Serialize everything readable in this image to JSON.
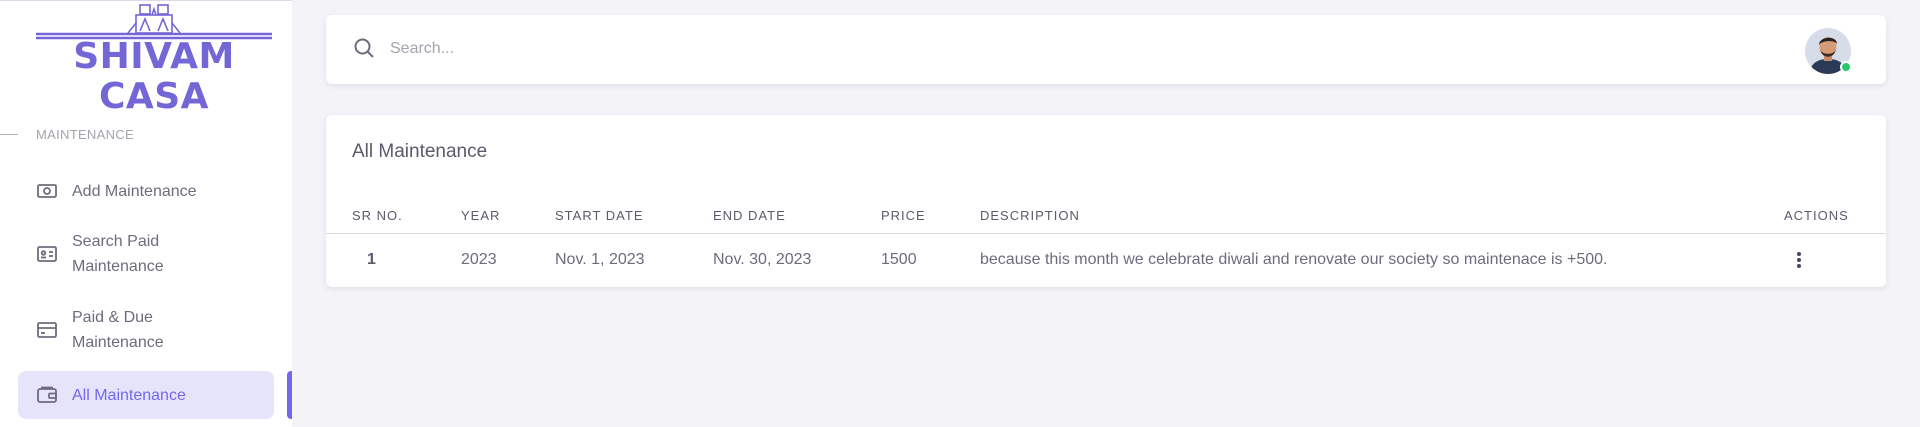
{
  "brand": {
    "name": "SHIVAM CASA",
    "color": "#7367d8"
  },
  "sidebar": {
    "section_header": "MAINTENANCE",
    "items": [
      {
        "label": "Add Maintenance",
        "icon": "cash-icon",
        "active": false
      },
      {
        "label": "Search Paid Maintenance",
        "icon": "id-card-icon",
        "active": false
      },
      {
        "label": "Paid & Due Maintenance",
        "icon": "credit-card-icon",
        "active": false
      },
      {
        "label": "All Maintenance",
        "icon": "wallet-icon",
        "active": true
      }
    ],
    "active_color": "#7367f0"
  },
  "search": {
    "placeholder": "Search..."
  },
  "user": {
    "avatar": "user-avatar",
    "status": "online",
    "status_color": "#28c76f"
  },
  "main": {
    "title": "All Maintenance",
    "columns": [
      "SR NO.",
      "YEAR",
      "START DATE",
      "END DATE",
      "PRICE",
      "DESCRIPTION",
      "ACTIONS"
    ],
    "rows": [
      {
        "sr": "1",
        "year": "2023",
        "start_date": "Nov. 1, 2023",
        "end_date": "Nov. 30, 2023",
        "price": "1500",
        "description": "because this month we celebrate diwali and renovate our society so maintenace is +500.",
        "actions_icon": "more-vertical-icon"
      }
    ]
  }
}
